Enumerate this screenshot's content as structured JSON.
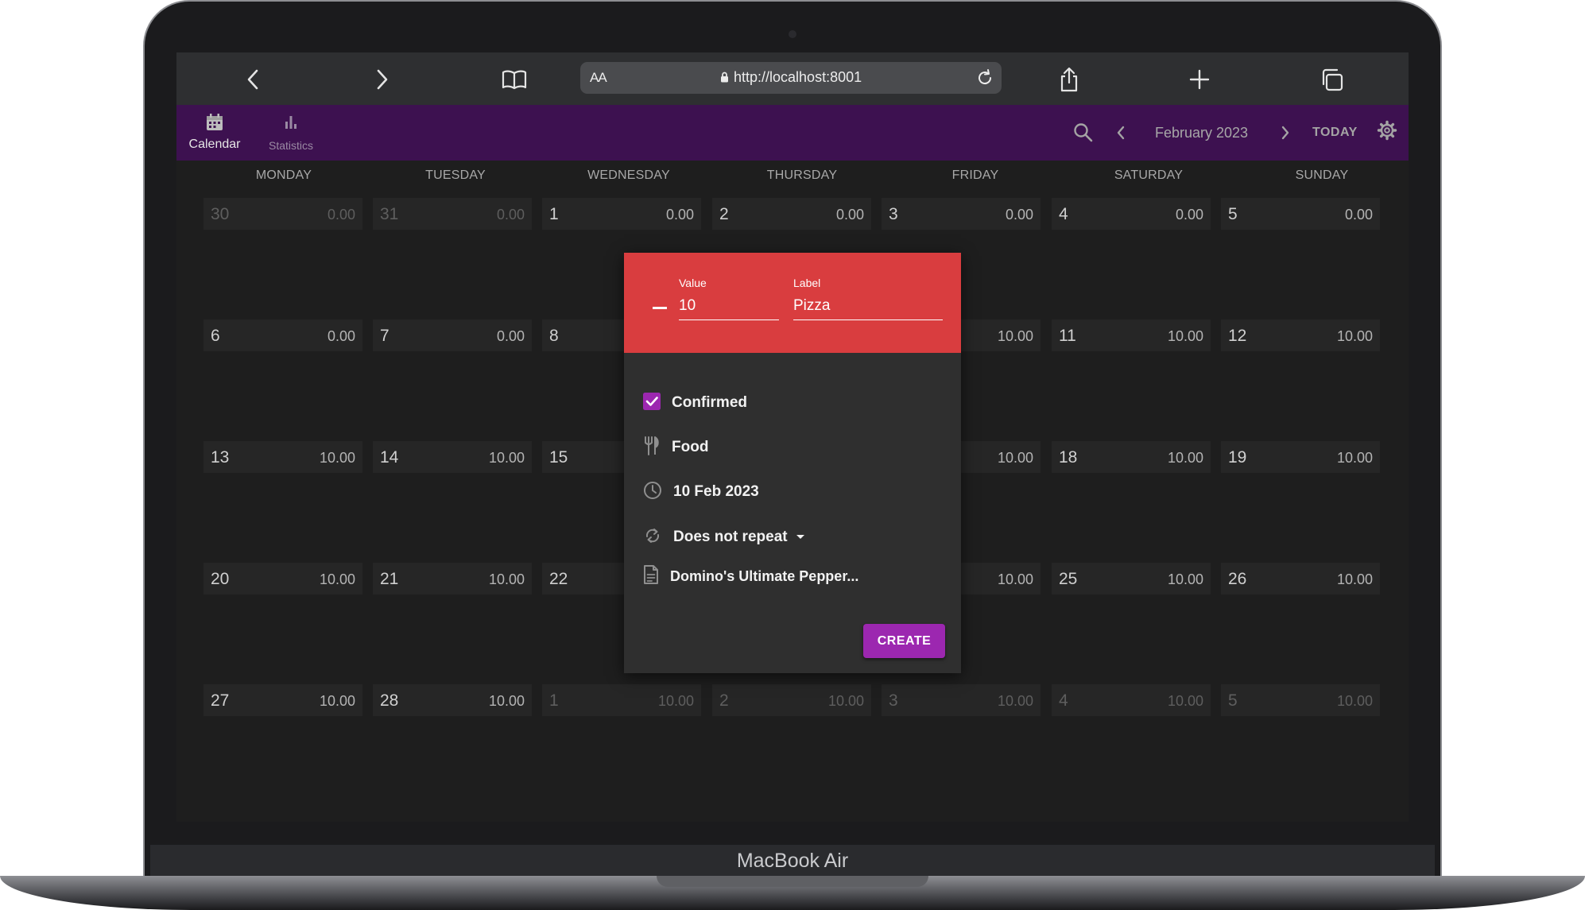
{
  "device": {
    "brand": "MacBook Air"
  },
  "browser": {
    "url": "http://localhost:8001",
    "reader_label": "AA",
    "icons": [
      "back-icon",
      "forward-icon",
      "bookmarks-icon",
      "share-icon",
      "new-tab-icon",
      "tabs-icon",
      "reload-icon",
      "lock-icon"
    ]
  },
  "app": {
    "colors": {
      "app_bar": "#3d1150",
      "accent": "#9c27b0",
      "dialog_header": "#d93d3f",
      "background": "#1e1e1e"
    },
    "nav": [
      {
        "label": "Calendar",
        "icon": "calendar-icon",
        "active": true
      },
      {
        "label": "Statistics",
        "icon": "bar-chart-icon",
        "active": false
      }
    ],
    "month_label": "February 2023",
    "today_label": "TODAY"
  },
  "weekdays": [
    "MONDAY",
    "TUESDAY",
    "WEDNESDAY",
    "THURSDAY",
    "FRIDAY",
    "SATURDAY",
    "SUNDAY"
  ],
  "weeks": [
    [
      {
        "day": "30",
        "amount": "0.00",
        "dim": true
      },
      {
        "day": "31",
        "amount": "0.00",
        "dim": true
      },
      {
        "day": "1",
        "amount": "0.00"
      },
      {
        "day": "2",
        "amount": "0.00"
      },
      {
        "day": "3",
        "amount": "0.00"
      },
      {
        "day": "4",
        "amount": "0.00"
      },
      {
        "day": "5",
        "amount": "0.00"
      }
    ],
    [
      {
        "day": "6",
        "amount": "0.00"
      },
      {
        "day": "7",
        "amount": "0.00"
      },
      {
        "day": "8",
        "amount": ""
      },
      {
        "day": "",
        "amount": ""
      },
      {
        "day": "",
        "amount": "10.00"
      },
      {
        "day": "11",
        "amount": "10.00"
      },
      {
        "day": "12",
        "amount": "10.00"
      }
    ],
    [
      {
        "day": "13",
        "amount": "10.00"
      },
      {
        "day": "14",
        "amount": "10.00"
      },
      {
        "day": "15",
        "amount": ""
      },
      {
        "day": "",
        "amount": ""
      },
      {
        "day": "",
        "amount": "10.00"
      },
      {
        "day": "18",
        "amount": "10.00"
      },
      {
        "day": "19",
        "amount": "10.00"
      }
    ],
    [
      {
        "day": "20",
        "amount": "10.00"
      },
      {
        "day": "21",
        "amount": "10.00"
      },
      {
        "day": "22",
        "amount": ""
      },
      {
        "day": "",
        "amount": ""
      },
      {
        "day": "",
        "amount": "10.00"
      },
      {
        "day": "25",
        "amount": "10.00"
      },
      {
        "day": "26",
        "amount": "10.00"
      }
    ],
    [
      {
        "day": "27",
        "amount": "10.00"
      },
      {
        "day": "28",
        "amount": "10.00"
      },
      {
        "day": "1",
        "amount": "10.00",
        "dim": true
      },
      {
        "day": "2",
        "amount": "10.00",
        "dim": true
      },
      {
        "day": "3",
        "amount": "10.00",
        "dim": true
      },
      {
        "day": "4",
        "amount": "10.00",
        "dim": true
      },
      {
        "day": "5",
        "amount": "10.00",
        "dim": true
      }
    ]
  ],
  "dialog": {
    "value_label": "Value",
    "value": "10",
    "label_label": "Label",
    "label_value": "Pizza",
    "confirmed_label": "Confirmed",
    "confirmed": true,
    "category": "Food",
    "date": "10 Feb 2023",
    "repeat": "Does not repeat",
    "note": "Domino's Ultimate Pepper...",
    "create_label": "CREATE"
  }
}
